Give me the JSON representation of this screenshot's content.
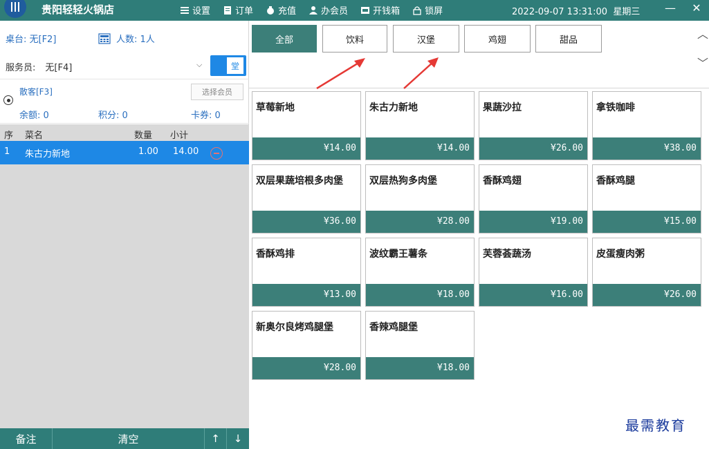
{
  "app": {
    "title": "贵阳轻轻火锅店",
    "menu": [
      {
        "label": "设置",
        "icon": "menu-icon"
      },
      {
        "label": "订单",
        "icon": "document-icon"
      },
      {
        "label": "充值",
        "icon": "money-bag-icon"
      },
      {
        "label": "办会员",
        "icon": "user-icon"
      },
      {
        "label": "开钱箱",
        "icon": "cash-drawer-icon"
      },
      {
        "label": "锁屏",
        "icon": "lock-icon"
      }
    ],
    "datetime": "2022-09-07 13:31:00",
    "weekday": "星期三",
    "minimize": "—",
    "close": "✕",
    "accent": "#2f7d79"
  },
  "order_info": {
    "table_label": "桌台: 无[F2]",
    "people_label": "人数: 1人",
    "waiter_label": "服务员:",
    "waiter_value": "无[F4]",
    "dine_mode": "堂",
    "customer": "散客[F3]",
    "select_member": "选择会员",
    "balance": "余额: 0",
    "points": "积分: 0",
    "coupons": "卡券: 0"
  },
  "order_list": {
    "headers": [
      "序",
      "菜名",
      "数量",
      "小计"
    ],
    "rows": [
      {
        "index": "1",
        "name": "朱古力新地",
        "qty": "1.00",
        "subtotal": "14.00"
      }
    ]
  },
  "bottom": {
    "note": "备注",
    "clear": "清空",
    "up": "↑",
    "down": "↓"
  },
  "categories": [
    {
      "label": "全部",
      "active": true
    },
    {
      "label": "饮料",
      "active": false
    },
    {
      "label": "汉堡",
      "active": false
    },
    {
      "label": "鸡翅",
      "active": false
    },
    {
      "label": "甜品",
      "active": false
    }
  ],
  "products": [
    {
      "name": "草莓新地",
      "price": "¥14.00"
    },
    {
      "name": "朱古力新地",
      "price": "¥14.00"
    },
    {
      "name": "果蔬沙拉",
      "price": "¥26.00"
    },
    {
      "name": "拿铁咖啡",
      "price": "¥38.00"
    },
    {
      "name": "双层果蔬培根多肉堡",
      "price": "¥36.00"
    },
    {
      "name": "双层热狗多肉堡",
      "price": "¥28.00"
    },
    {
      "name": "香酥鸡翅",
      "price": "¥19.00"
    },
    {
      "name": "香酥鸡腿",
      "price": "¥15.00"
    },
    {
      "name": "香酥鸡排",
      "price": "¥13.00"
    },
    {
      "name": "波纹霸王薯条",
      "price": "¥18.00"
    },
    {
      "name": "芙蓉荟蔬汤",
      "price": "¥16.00"
    },
    {
      "name": "皮蛋瘦肉粥",
      "price": "¥26.00"
    },
    {
      "name": "新奥尔良烤鸡腿堡",
      "price": "¥28.00"
    },
    {
      "name": "香辣鸡腿堡",
      "price": "¥18.00"
    }
  ],
  "watermark": "最需教育"
}
